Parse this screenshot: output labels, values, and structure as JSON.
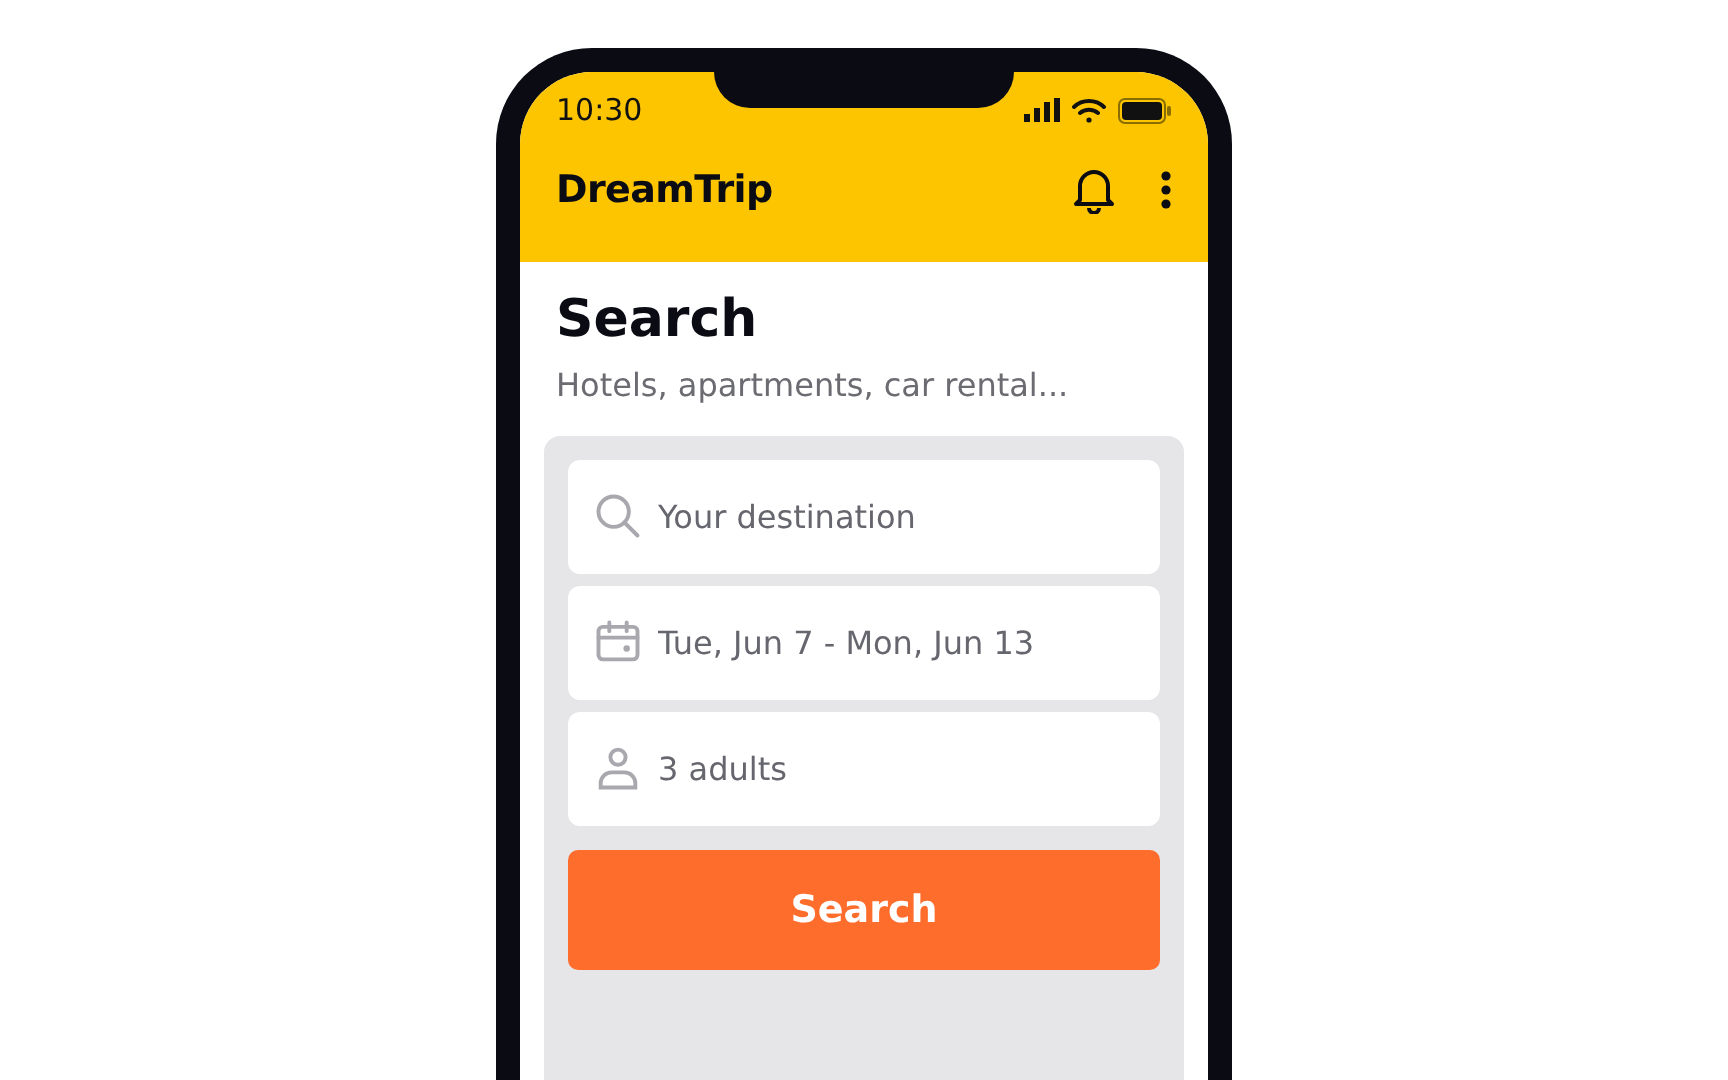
{
  "status_bar": {
    "time": "10:30"
  },
  "app_bar": {
    "title": "DreamTrip"
  },
  "header": {
    "title": "Search",
    "subtitle": "Hotels, apartments, car rental..."
  },
  "fields": [
    {
      "kind": "destination",
      "placeholder": "Your destination"
    },
    {
      "kind": "dates",
      "value": "Tue, Jun 7 - Mon, Jun 13"
    },
    {
      "kind": "guests",
      "value": "3 adults"
    }
  ],
  "search_button": {
    "label": "Search"
  }
}
